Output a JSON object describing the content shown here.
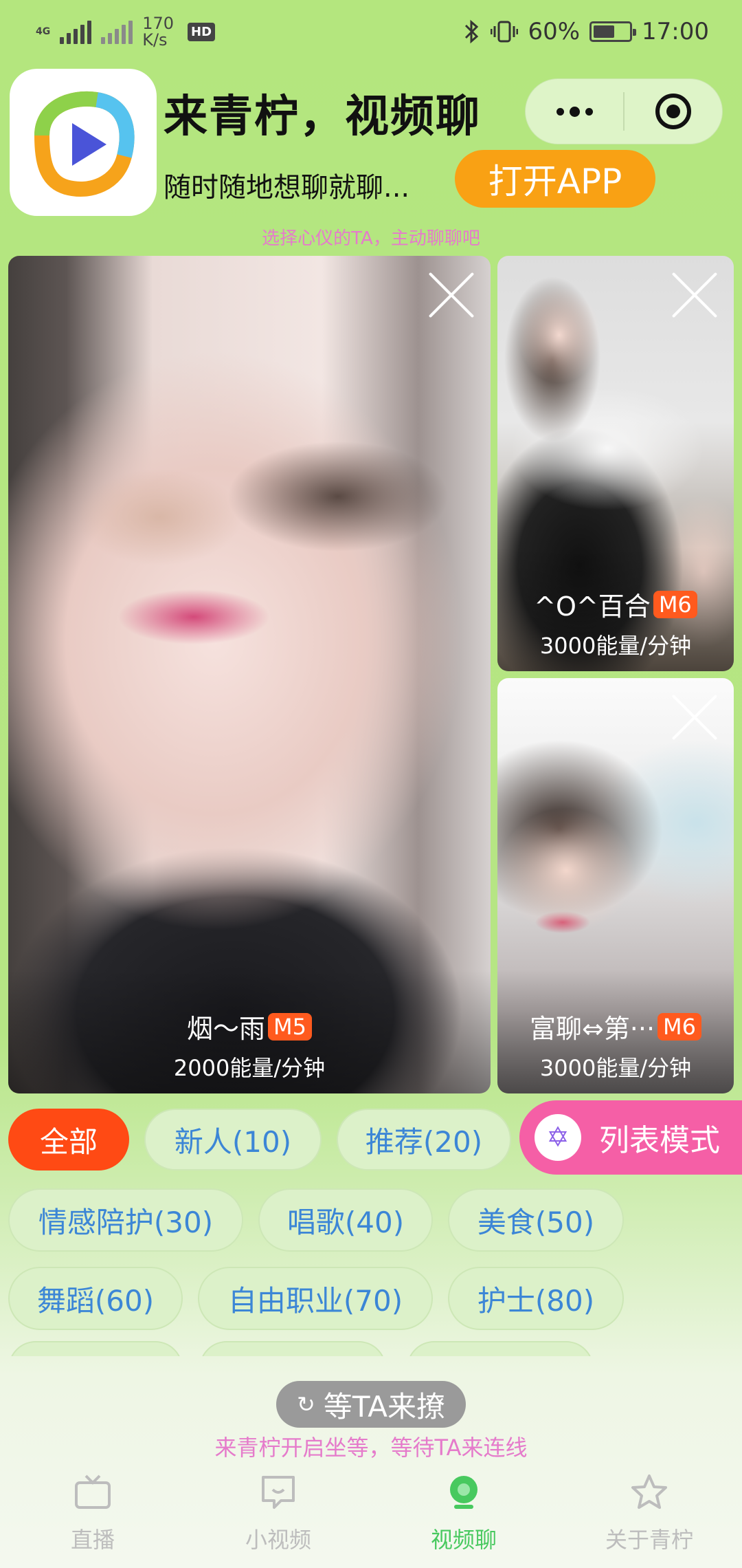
{
  "status_bar": {
    "network_tag": "4G",
    "speed_value": "170",
    "speed_unit": "K/s",
    "hd": "HD",
    "battery_percent": "60%",
    "battery_level": 0.6,
    "time": "17:00"
  },
  "header": {
    "title": "来青柠，视频聊",
    "subtitle": "随时随地想聊就聊...",
    "open_app_label": "打开APP",
    "hint": "选择心仪的TA，主动聊聊吧"
  },
  "cards": [
    {
      "name": "烟～雨",
      "level": "M5",
      "price": "2000能量/分钟"
    },
    {
      "name": "^O^百合",
      "level": "M6",
      "price": "3000能量/分钟"
    },
    {
      "name": "富聊⇔第···",
      "level": "M6",
      "price": "3000能量/分钟"
    }
  ],
  "categories": {
    "row1": [
      "全部",
      "新人(10)",
      "推荐(20)"
    ],
    "row2": [
      "情感陪护(30)",
      "唱歌(40)",
      "美食(50)"
    ],
    "row3": [
      "舞蹈(60)",
      "自由职业(70)",
      "护士(80)"
    ],
    "list_mode_label": "列表模式",
    "list_mode_icon": "✡"
  },
  "wait": {
    "button_label": "等TA来撩",
    "spin_icon": "↻",
    "hint": "来青柠开启坐等，等待TA来连线"
  },
  "nav": [
    {
      "label": "直播",
      "icon": "tv-icon"
    },
    {
      "label": "小视频",
      "icon": "chat-video-icon"
    },
    {
      "label": "视频聊",
      "icon": "video-chat-icon"
    },
    {
      "label": "关于青柠",
      "icon": "star-icon"
    }
  ],
  "colors": {
    "background": "#b4e67e",
    "accent_orange": "#f9a114",
    "active_chip": "#ff4a14",
    "list_mode_pink": "#f55fa6",
    "nav_active": "#48c95f"
  }
}
